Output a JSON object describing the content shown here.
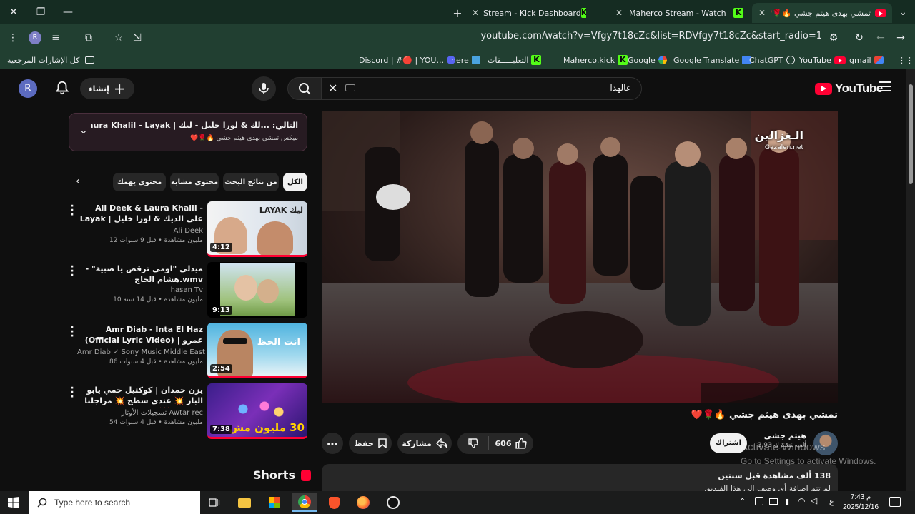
{
  "browser": {
    "tabs": [
      {
        "title": "تمشي بهدى هيثم جشي 🔥🌹❤️",
        "active": true
      },
      {
        "title": "Maherco Stream - Watch Live o",
        "active": false
      },
      {
        "title": "Stream - Kick Dashboard",
        "active": false
      }
    ],
    "new_tab": "+",
    "url": "youtube.com/watch?v=Vfgy7t18cZc&list=RDVfgy7t18cZc&start_radio=1",
    "profile_initial": "R",
    "bookmarks": [
      {
        "label": "gmail",
        "icon": "gmail-icon"
      },
      {
        "label": "YouTube",
        "icon": "youtube-icon"
      },
      {
        "label": "ChatGPT",
        "icon": "chatgpt-icon"
      },
      {
        "label": "Google Translate",
        "icon": "translate-icon"
      },
      {
        "label": "Google",
        "icon": "google-icon"
      },
      {
        "label": "Maherco.kick",
        "icon": "kick-icon"
      },
      {
        "label": "التعليـــــقات",
        "icon": "kick-icon"
      },
      {
        "label": "here",
        "icon": "link-icon"
      },
      {
        "label": "Discord | #🔴 | YOU...",
        "icon": "discord-icon"
      }
    ],
    "all_bookmarks": "كل الإشارات المرجعية"
  },
  "youtube": {
    "logo_text": "YouTube",
    "search_value": "عالهدا",
    "create_label": "إنشاء",
    "avatar_initial": "R",
    "queue": {
      "title": "التالي: ...لك & لورا خليل - ليك | Ali Deek & Laura Khalil - Layak",
      "subtitle": "ميكس تمشي بهدى هيثم جشي 🔥🌹❤️"
    },
    "chips": [
      {
        "label": "الكل",
        "selected": true
      },
      {
        "label": "من نتائج البحث",
        "selected": false
      },
      {
        "label": "محتوى مشابه",
        "selected": false
      },
      {
        "label": "محتوى يهمك",
        "selected": false
      }
    ],
    "recommendations": [
      {
        "title": "Ali Deek & Laura Khalil - Layak | علي الديك & لورا خليل - ليك",
        "channel": "Ali Deek",
        "verified": true,
        "stats": "12 مليون مشاهدة • قبل 9 سنوات",
        "duration": "4:12",
        "thumb_text": "LAYAK ليك"
      },
      {
        "title": "ميدلي \"اومي ترقص يا صبية\" - هشام الحاج.wmv",
        "channel": "hasan Tv",
        "verified": false,
        "stats": "10 مليون مشاهدة • قبل 14 سنة",
        "duration": "9:13",
        "thumb_text": ""
      },
      {
        "title": "Amr Diab - Inta El Haz (Official Lyric Video) | عمرو دياب - (كلمات) |",
        "channel": "Amr Diab ✓ Sony Music Middle East",
        "verified": true,
        "stats": "86 مليون مشاهدة • قبل 4 سنوات",
        "duration": "2:54",
        "thumb_text": "انت الحظ"
      },
      {
        "title": "يزن حمدان | كوكتيل حمي يابو البار 💥 عندي سطح 💥 مراجلنا تصدد 💥 صباح ...",
        "channel": "تسجيلات الأوتار Awtar rec",
        "verified": false,
        "stats": "54 مليون مشاهدة • قبل 4 سنوات",
        "duration": "7:38",
        "thumb_text": "30 مليون مش"
      }
    ],
    "shorts_label": "Shorts",
    "video": {
      "title": "تمشي بهدى هيثم جشي 🔥🌹❤️",
      "watermark": "الـغزالين",
      "watermark_sub": "Gazalen.net",
      "channel": "هيثم جشي",
      "subscribers": "3.93 ألف مشترك",
      "subscribe_label": "اشتراك",
      "likes": "606",
      "share_label": "مشاركة",
      "save_label": "حفظ",
      "views_line": "138 ألف مشاهدة  قبل سنتين",
      "desc_line": "لم تتم إضافة أي وصف إلى هذا الفيديو."
    },
    "activate_windows": {
      "title": "Activate Windows",
      "subtitle": "Go to Settings to activate Windows."
    }
  },
  "taskbar": {
    "search_placeholder": "Type here to search",
    "time": "7:43 م",
    "date": "2025/12/16",
    "lang": "ع"
  }
}
